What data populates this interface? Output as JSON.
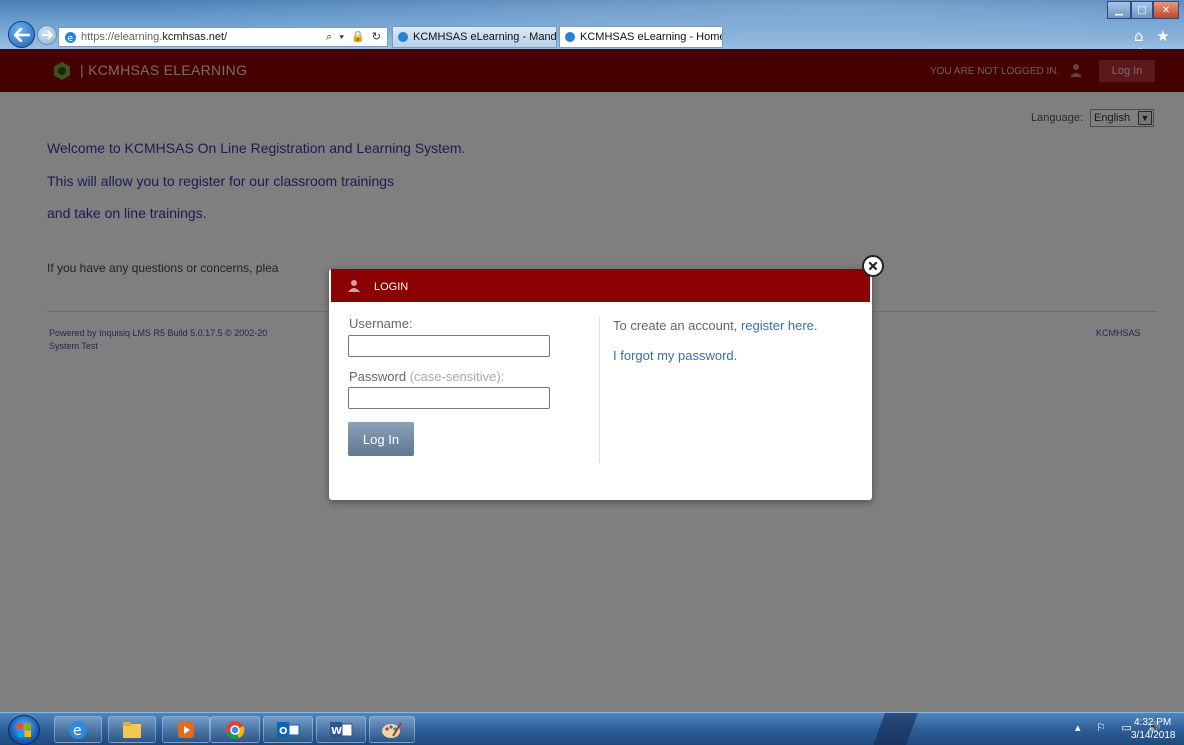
{
  "browser": {
    "address_prefix": "https://elearning.",
    "address_domain": "kcmhsas.net/",
    "address_actions": "⌕ ▾ 🔒 ↻",
    "tabs": [
      {
        "label": "KCMHSAS eLearning - Mandt ..."
      },
      {
        "label": "KCMHSAS eLearning - Home",
        "close": "×"
      }
    ],
    "tool_icons": "⌂ ★ ⚙"
  },
  "header": {
    "site_title": "| KCMHSAS ELEARNING",
    "not_logged_in": "YOU ARE NOT LOGGED IN.",
    "login_button": "Log In"
  },
  "language": {
    "label": "Language:",
    "selected": "English"
  },
  "main": {
    "welcome_lines": [
      "Welcome to KCMHSAS On Line Registration and Learning System.",
      "This will allow you to register for our classroom trainings",
      "and take on line trainings."
    ],
    "questions_text": "If you have any questions or concerns, plea"
  },
  "footer": {
    "powered_by": "Powered by Inquisiq LMS R5 Build 5.0.17.5 © 2002-20",
    "system_test": "System Test",
    "org": "KCMHSAS"
  },
  "dialog": {
    "title": "LOGIN",
    "username_label": "Username:",
    "password_label": "Password",
    "password_hint": "(case-sensitive):",
    "username_value": "",
    "password_value": "",
    "login_button": "Log In",
    "create_account_text": "To create an account,",
    "register_link": "register here.",
    "forgot_link": "I forgot my password."
  },
  "taskbar": {
    "clock_time": "4:32 PM",
    "clock_date": "3/14/2018",
    "tray_icons": "▴ ⚐ ▭ 🔊"
  },
  "colors": {
    "header_red": "#8b0000",
    "link_blue": "#3a6ea8",
    "welcome_blue": "#3838a8"
  }
}
